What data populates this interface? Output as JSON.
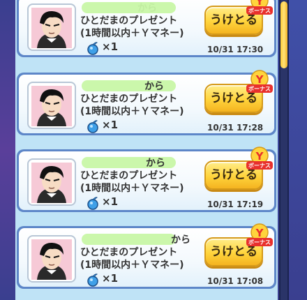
{
  "scroll": {
    "position": 0.0
  },
  "messages": [
    {
      "from_suffix": "から",
      "title": "ひとだまのプレゼント",
      "detail": "(1時間以内＋Ｙマネー)",
      "quantity": "×1",
      "time": "10/31 17:30",
      "button": "うけとる",
      "badge": "ボーナス"
    },
    {
      "from_suffix": "から",
      "title": "ひとだまのプレゼント",
      "detail": "(1時間以内＋Ｙマネー)",
      "quantity": "×1",
      "time": "10/31 17:28",
      "button": "うけとる",
      "badge": "ボーナス"
    },
    {
      "from_suffix": "から",
      "title": "ひとだまのプレゼント",
      "detail": "(1時間以内＋Ｙマネー)",
      "quantity": "×1",
      "time": "10/31 17:19",
      "button": "うけとる",
      "badge": "ボーナス"
    },
    {
      "from_suffix": "から",
      "title": "ひとだまのプレゼント",
      "detail": "(1時間以内＋Ｙマネー)",
      "quantity": "×1",
      "time": "10/31 17:08",
      "button": "うけとる",
      "badge": "ボーナス"
    }
  ],
  "colors": {
    "button": "#ffd43c",
    "card_border": "#5d86c8",
    "badge_red": "#e8302c",
    "orb_blue": "#3fa0e8"
  },
  "icons": {
    "avatar": "character-portrait",
    "item": "hitodama-orb-icon",
    "badge": "y-bonus-badge-icon"
  }
}
